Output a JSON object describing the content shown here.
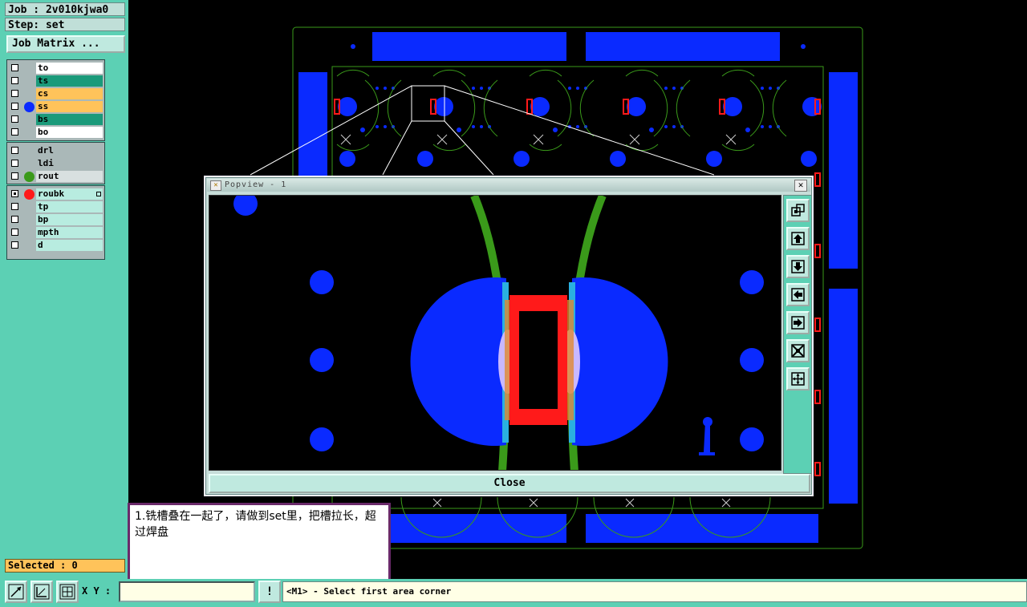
{
  "job": {
    "label": "Job : 2v010kjwa0"
  },
  "step": {
    "label": "Step: set"
  },
  "job_matrix_button": "Job Matrix ...",
  "layer_groups": [
    [
      {
        "name": "to",
        "bg": "#ffffff",
        "dot": null
      },
      {
        "name": "ts",
        "bg": "#1a9a7a",
        "dot": null
      },
      {
        "name": "cs",
        "bg": "#ffc35a",
        "dot": null
      },
      {
        "name": "ss",
        "bg": "#ffc35a",
        "dot": "#0a2aff"
      },
      {
        "name": "bs",
        "bg": "#1a9a7a",
        "dot": null
      },
      {
        "name": "bo",
        "bg": "#ffffff",
        "dot": null
      }
    ],
    [
      {
        "name": "drl",
        "bg": "#aab8b8",
        "dot": null
      },
      {
        "name": "ldi",
        "bg": "#aab8b8",
        "dot": null
      },
      {
        "name": "rout",
        "bg": "#d8e0e0",
        "dot": "#3a9a1a"
      }
    ],
    [
      {
        "name": "roubk",
        "bg": "#b8ece0",
        "dot": "#ff1a1a"
      },
      {
        "name": "tp",
        "bg": "#b8ece0",
        "dot": null
      },
      {
        "name": "bp",
        "bg": "#b8ece0",
        "dot": null
      },
      {
        "name": "mpth",
        "bg": "#b8ece0",
        "dot": null
      },
      {
        "name": "d",
        "bg": "#b8ece0",
        "dot": null
      }
    ]
  ],
  "selected_label": "Selected : 0",
  "popview": {
    "title": "Popview - 1",
    "close_label": "Close"
  },
  "note": {
    "text": "1.铣槽叠在一起了，请做到set里，把槽拉长，超过焊盘"
  },
  "bottom": {
    "xy_label": "X Y :",
    "xy_value": "",
    "status": "<M1> - Select first area corner"
  },
  "colors": {
    "panel": "#5cd0b4",
    "pad": "#0a2aff",
    "rout": "#3a9a1a",
    "slot": "#ff1a1a"
  }
}
